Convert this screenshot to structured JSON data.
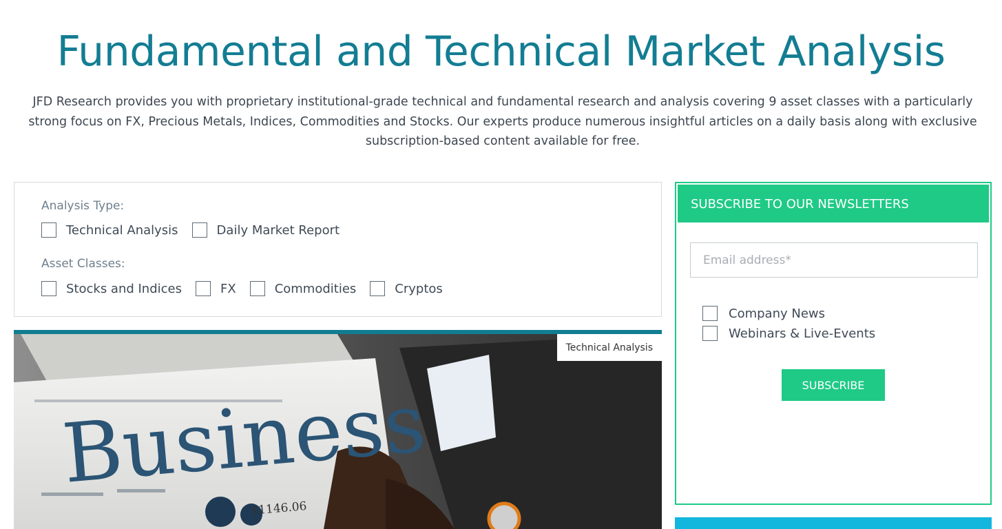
{
  "page": {
    "title": "Fundamental and Technical Market Analysis",
    "intro": "JFD Research provides you with proprietary institutional-grade technical and fundamental research and analysis covering 9 asset classes with a particularly strong focus on FX, Precious Metals, Indices, Commodities and Stocks. Our experts produce numerous insightful articles on a daily basis along with exclusive subscription-based content available for free."
  },
  "filters": {
    "analysis_type_label": "Analysis Type:",
    "analysis_types": [
      {
        "label": "Technical Analysis",
        "checked": false
      },
      {
        "label": "Daily Market Report",
        "checked": false
      }
    ],
    "asset_classes_label": "Asset Classes:",
    "asset_classes": [
      {
        "label": "Stocks and Indices",
        "checked": false
      },
      {
        "label": "FX",
        "checked": false
      },
      {
        "label": "Commodities",
        "checked": false
      },
      {
        "label": "Cryptos",
        "checked": false
      }
    ]
  },
  "article": {
    "category_badge": "Technical Analysis",
    "image_headline": "Business",
    "image_price": "$1146.06"
  },
  "newsletter": {
    "header": "SUBSCRIBE TO OUR NEWSLETTERS",
    "email_placeholder": "Email address*",
    "options": [
      {
        "label": "Company News",
        "checked": false
      },
      {
        "label": "Webinars & Live-Events",
        "checked": false
      }
    ],
    "subscribe_label": "SUBSCRIBE"
  },
  "colors": {
    "title": "#137d93",
    "accent_green": "#1fca86",
    "card_border": "#117d91",
    "next_panel": "#13b6dd"
  }
}
